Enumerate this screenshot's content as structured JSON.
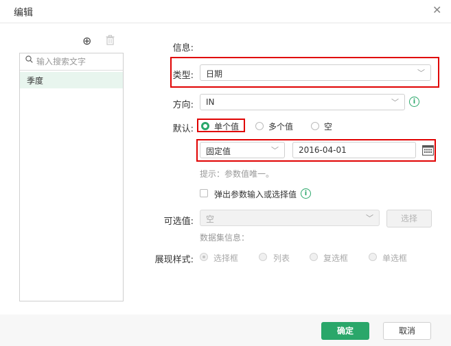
{
  "dialog": {
    "title": "编辑"
  },
  "left_panel": {
    "search_placeholder": "输入搜索文字",
    "items": [
      {
        "label": "季度"
      }
    ]
  },
  "form": {
    "info_label": "信息:",
    "type_label": "类型:",
    "type_value": "日期",
    "direction_label": "方向:",
    "direction_value": "IN",
    "default_label": "默认:",
    "default_options": [
      {
        "label": "单个值",
        "selected": true
      },
      {
        "label": "多个值",
        "selected": false
      },
      {
        "label": "空",
        "selected": false
      }
    ],
    "value_source": "固定值",
    "date_value": "2016-04-01",
    "hint": "提示：参数值唯一。",
    "popup_checkbox_label": "弹出参数输入或选择值",
    "popup_checked": false,
    "optional_label": "可选值:",
    "optional_value": "空",
    "select_button": "选择",
    "dataset_info": "数据集信息：",
    "display_style_label": "展现样式:",
    "display_styles": [
      {
        "label": "选择框",
        "selected": true
      },
      {
        "label": "列表",
        "selected": false
      },
      {
        "label": "复选框",
        "selected": false
      },
      {
        "label": "单选框",
        "selected": false
      }
    ]
  },
  "footer": {
    "ok": "确定",
    "cancel": "取消"
  },
  "colors": {
    "accent": "#2aa76a",
    "highlight": "#e00000",
    "list_selected_bg": "#e8f5ee"
  }
}
